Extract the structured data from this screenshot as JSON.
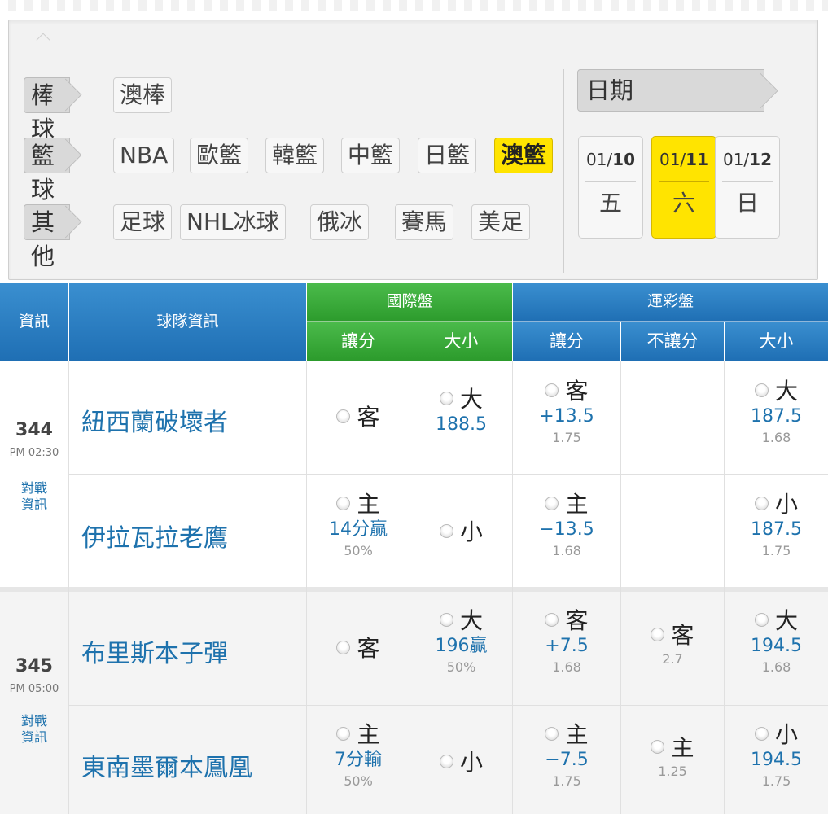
{
  "filters": {
    "rows": [
      {
        "category": "棒球",
        "items": [
          {
            "label": "澳棒",
            "active": false
          }
        ]
      },
      {
        "category": "籃球",
        "items": [
          {
            "label": "NBA",
            "active": false
          },
          {
            "label": "歐籃",
            "active": false
          },
          {
            "label": "韓籃",
            "active": false
          },
          {
            "label": "中籃",
            "active": false
          },
          {
            "label": "日籃",
            "active": false
          },
          {
            "label": "澳籃",
            "active": true
          }
        ]
      },
      {
        "category": "其他",
        "items": [
          {
            "label": "足球",
            "active": false
          },
          {
            "label": "NHL冰球",
            "active": false
          },
          {
            "label": "俄冰",
            "active": false
          },
          {
            "label": "賽馬",
            "active": false
          },
          {
            "label": "美足",
            "active": false
          }
        ]
      }
    ]
  },
  "dates": {
    "title": "日期",
    "items": [
      {
        "month": "01/",
        "day": "10",
        "weekday": "五",
        "active": false
      },
      {
        "month": "01/",
        "day": "11",
        "weekday": "六",
        "active": true
      },
      {
        "month": "01/",
        "day": "12",
        "weekday": "日",
        "active": false
      }
    ]
  },
  "table": {
    "col_info": "資訊",
    "col_team": "球隊資訊",
    "intl_group": "國際盤",
    "intl_spread": "讓分",
    "intl_total": "大小",
    "lottery_group": "運彩盤",
    "lot_spread": "讓分",
    "lot_moneyline": "不讓分",
    "lot_total": "大小"
  },
  "matches": [
    {
      "number": "344",
      "time": "PM 02:30",
      "vs_line1": "對戰",
      "vs_line2": "資訊",
      "away": {
        "team": "紐西蘭破壞者",
        "intl_spread": {
          "label": "客",
          "value": "",
          "pct": ""
        },
        "intl_total": {
          "label": "大",
          "value": "188.5",
          "pct": ""
        },
        "lot_spread": {
          "label": "客",
          "value": "+13.5",
          "odds": "1.75"
        },
        "lot_ml": {
          "label": "",
          "odds": ""
        },
        "lot_total": {
          "label": "大",
          "value": "187.5",
          "odds": "1.68"
        }
      },
      "home": {
        "team": "伊拉瓦拉老鷹",
        "intl_spread": {
          "label": "主",
          "value": "14分贏",
          "pct": "50%"
        },
        "intl_total": {
          "label": "小",
          "value": "",
          "pct": ""
        },
        "lot_spread": {
          "label": "主",
          "value": "−13.5",
          "odds": "1.68"
        },
        "lot_ml": {
          "label": "",
          "odds": ""
        },
        "lot_total": {
          "label": "小",
          "value": "187.5",
          "odds": "1.75"
        }
      }
    },
    {
      "number": "345",
      "time": "PM 05:00",
      "vs_line1": "對戰",
      "vs_line2": "資訊",
      "away": {
        "team": "布里斯本子彈",
        "intl_spread": {
          "label": "客",
          "value": "",
          "pct": ""
        },
        "intl_total": {
          "label": "大",
          "value": "196贏",
          "pct": "50%"
        },
        "lot_spread": {
          "label": "客",
          "value": "+7.5",
          "odds": "1.68"
        },
        "lot_ml": {
          "label": "客",
          "odds": "2.7"
        },
        "lot_total": {
          "label": "大",
          "value": "194.5",
          "odds": "1.68"
        }
      },
      "home": {
        "team": "東南墨爾本鳳凰",
        "intl_spread": {
          "label": "主",
          "value": "7分輸",
          "pct": "50%"
        },
        "intl_total": {
          "label": "小",
          "value": "",
          "pct": ""
        },
        "lot_spread": {
          "label": "主",
          "value": "−7.5",
          "odds": "1.75"
        },
        "lot_ml": {
          "label": "主",
          "odds": "1.25"
        },
        "lot_total": {
          "label": "小",
          "value": "194.5",
          "odds": "1.75"
        }
      }
    }
  ]
}
